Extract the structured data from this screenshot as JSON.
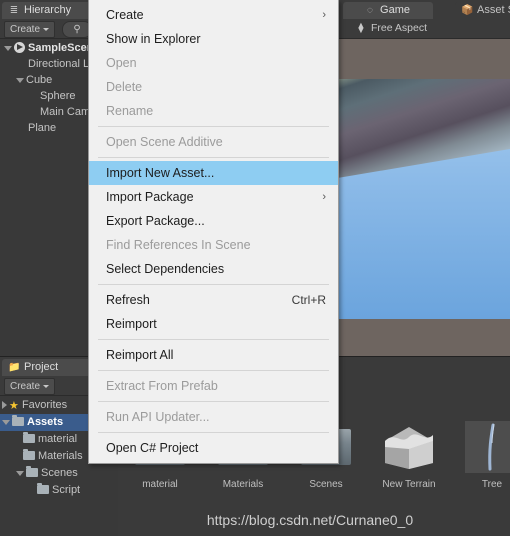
{
  "app": "Unity Editor",
  "hierarchy": {
    "tab": {
      "label": "Hierarchy",
      "icon": "hierarchy-icon"
    },
    "create_label": "Create",
    "items": [
      {
        "label": "SampleScene",
        "indent": 0,
        "expanded": true,
        "selected": true,
        "icon": "unity-scene-icon"
      },
      {
        "label": "Directional Light",
        "indent": 2,
        "expanded": false,
        "selected": false,
        "icon": ""
      },
      {
        "label": "Cube",
        "indent": 1,
        "expanded": true,
        "selected": false,
        "icon": ""
      },
      {
        "label": "Sphere",
        "indent": 3,
        "expanded": false,
        "selected": false,
        "icon": ""
      },
      {
        "label": "Main Camera",
        "indent": 3,
        "expanded": false,
        "selected": false,
        "icon": ""
      },
      {
        "label": "Plane",
        "indent": 2,
        "expanded": false,
        "selected": false,
        "icon": ""
      }
    ]
  },
  "project": {
    "tab": {
      "label": "Project",
      "icon": "folder-icon"
    },
    "create_label": "Create",
    "tree": [
      {
        "label": "Favorites",
        "indent": 0,
        "expanded": false,
        "selected": false,
        "icon": "star-icon"
      },
      {
        "label": "Assets",
        "indent": 0,
        "expanded": true,
        "selected": true,
        "icon": "folder-icon"
      },
      {
        "label": "material",
        "indent": 1,
        "expanded": false,
        "selected": false,
        "icon": "folder-icon"
      },
      {
        "label": "Materials",
        "indent": 1,
        "expanded": false,
        "selected": false,
        "icon": "folder-icon"
      },
      {
        "label": "Scenes",
        "indent": 1,
        "expanded": true,
        "selected": false,
        "icon": "folder-icon"
      },
      {
        "label": "Script",
        "indent": 2,
        "expanded": false,
        "selected": false,
        "icon": "folder-icon"
      }
    ]
  },
  "game_view": {
    "tabs": [
      {
        "label": "Game",
        "icon": "game-pacman-icon",
        "active": true
      },
      {
        "label": "Asset Store",
        "icon": "asset-store-icon",
        "active": false
      }
    ],
    "aspect_label": "Free Aspect"
  },
  "assets_browser": {
    "items": [
      {
        "label": "material",
        "icon": "folder-thumb"
      },
      {
        "label": "Materials",
        "icon": "folder-thumb"
      },
      {
        "label": "Scenes",
        "icon": "folder-thumb"
      },
      {
        "label": "New Terrain",
        "icon": "terrain-thumb"
      },
      {
        "label": "Tree",
        "icon": "tree-thumb"
      }
    ],
    "watermark": "https://blog.csdn.net/Curnane0_0"
  },
  "context_menu": {
    "items": [
      {
        "label": "Create",
        "state": "normal",
        "submenu": true,
        "shortcut": ""
      },
      {
        "label": "Show in Explorer",
        "state": "normal",
        "submenu": false,
        "shortcut": ""
      },
      {
        "label": "Open",
        "state": "disabled",
        "submenu": false,
        "shortcut": ""
      },
      {
        "label": "Delete",
        "state": "disabled",
        "submenu": false,
        "shortcut": ""
      },
      {
        "label": "Rename",
        "state": "disabled",
        "submenu": false,
        "shortcut": ""
      },
      {
        "label": "__sep__",
        "state": "sep",
        "submenu": false,
        "shortcut": ""
      },
      {
        "label": "Open Scene Additive",
        "state": "disabled",
        "submenu": false,
        "shortcut": ""
      },
      {
        "label": "__sep__",
        "state": "sep",
        "submenu": false,
        "shortcut": ""
      },
      {
        "label": "Import New Asset...",
        "state": "highlighted",
        "submenu": false,
        "shortcut": ""
      },
      {
        "label": "Import Package",
        "state": "normal",
        "submenu": true,
        "shortcut": ""
      },
      {
        "label": "Export Package...",
        "state": "normal",
        "submenu": false,
        "shortcut": ""
      },
      {
        "label": "Find References In Scene",
        "state": "disabled",
        "submenu": false,
        "shortcut": ""
      },
      {
        "label": "Select Dependencies",
        "state": "normal",
        "submenu": false,
        "shortcut": ""
      },
      {
        "label": "__sep__",
        "state": "sep",
        "submenu": false,
        "shortcut": ""
      },
      {
        "label": "Refresh",
        "state": "normal",
        "submenu": false,
        "shortcut": "Ctrl+R"
      },
      {
        "label": "Reimport",
        "state": "normal",
        "submenu": false,
        "shortcut": ""
      },
      {
        "label": "__sep__",
        "state": "sep",
        "submenu": false,
        "shortcut": ""
      },
      {
        "label": "Reimport All",
        "state": "normal",
        "submenu": false,
        "shortcut": ""
      },
      {
        "label": "__sep__",
        "state": "sep",
        "submenu": false,
        "shortcut": ""
      },
      {
        "label": "Extract From Prefab",
        "state": "disabled",
        "submenu": false,
        "shortcut": ""
      },
      {
        "label": "__sep__",
        "state": "sep",
        "submenu": false,
        "shortcut": ""
      },
      {
        "label": "Run API Updater...",
        "state": "disabled",
        "submenu": false,
        "shortcut": ""
      },
      {
        "label": "__sep__",
        "state": "sep",
        "submenu": false,
        "shortcut": ""
      },
      {
        "label": "Open C# Project",
        "state": "normal",
        "submenu": false,
        "shortcut": ""
      }
    ],
    "submenu_glyph": "›"
  },
  "colors": {
    "menu_bg": "#f0f0f0",
    "menu_highlight": "#8ecdf2",
    "panel_bg": "#393939",
    "selection_blue": "#3a5c8c",
    "game_letterbox": "#6e6560",
    "sky": "#8dbbe8"
  }
}
